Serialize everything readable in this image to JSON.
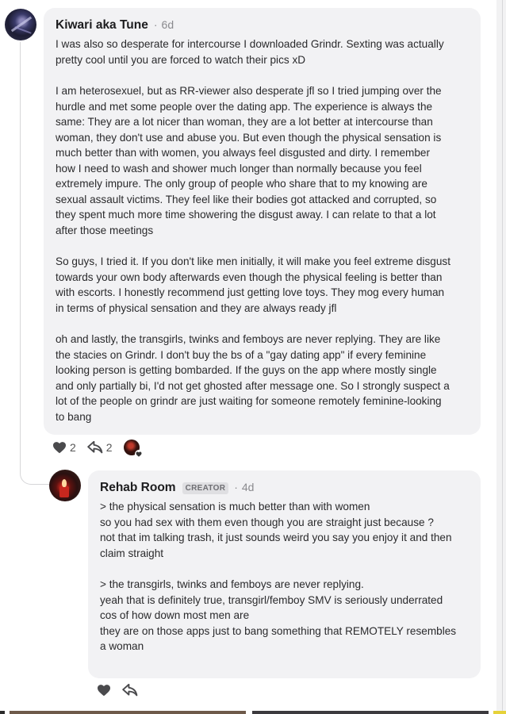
{
  "comment": {
    "author": "Kiwari aka Tune",
    "separator": "·",
    "time": "6d",
    "paragraphs": [
      [
        "I was also so desperate for intercourse I downloaded Grindr. Sexting was actually",
        "pretty cool until you are forced to watch their pics xD"
      ],
      [
        "I am heterosexuel, but as RR-viewer also desperate jfl so I tried jumping over the",
        "hurdle and met some people over the dating app. The experience is always the",
        "same: They are a lot nicer than woman, they are a lot better at intercourse than",
        "woman, they don't use and abuse you. But even though the physical sensation is",
        "much better than with women, you always feel disgusted and dirty. I remember",
        "how I need to wash and shower much longer than normally because you feel",
        "extremely impure. The only group of people who share that to my knowing are",
        "sexual assault victims. They feel like their bodies got attacked and corrupted, so",
        "they spent much more time showering the disgust away. I can relate to that a lot",
        "after those meetings"
      ],
      [
        "So guys, I tried it. If you don't like men initially, it will make you feel extreme disgust",
        "towards your own body afterwards even though the physical feeling is better than",
        "with escorts. I honestly recommend just getting love toys. They mog every human",
        "in terms of physical sensation and they are always ready jfl"
      ],
      [
        "oh and lastly, the transgirls, twinks and femboys are never replying. They are like",
        "the stacies on Grindr. I don't buy the bs of a \"gay dating app\" if every feminine",
        "looking person is getting bombarded. If the guys on the app where mostly single",
        "and only partially bi, I'd not get ghosted after message one. So I strongly suspect a",
        "lot of the people on grindr are just waiting for someone remotely feminine-looking",
        "to bang"
      ]
    ],
    "like_count": "2",
    "share_count": "2",
    "icons": {
      "like": "heart-icon",
      "share": "share-arrow-icon",
      "reactor": "reactor-avatar"
    }
  },
  "reply": {
    "author": "Rehab Room",
    "badge": "CREATOR",
    "separator": "·",
    "time": "4d",
    "paragraphs": [
      [
        "> the physical sensation is much better than with women",
        "so you had sex with them even though you are straight just because ?",
        "not that im talking trash, it just sounds weird you say you enjoy it and then",
        "claim straight"
      ],
      [
        "> the transgirls, twinks and femboys are never replying.",
        "yeah that is definitely true, transgirl/femboy SMV is seriously underrated",
        "cos of how down most men are",
        "they are on those apps just to bang something that REMOTELY resembles",
        "a woman"
      ]
    ],
    "icons": {
      "like": "heart-icon",
      "share": "share-arrow-icon"
    }
  },
  "colors": {
    "bubble": "#f2f2f4",
    "text": "#2a2a2c",
    "muted": "#8a8a8e",
    "badge_bg": "#dfdfe2"
  }
}
